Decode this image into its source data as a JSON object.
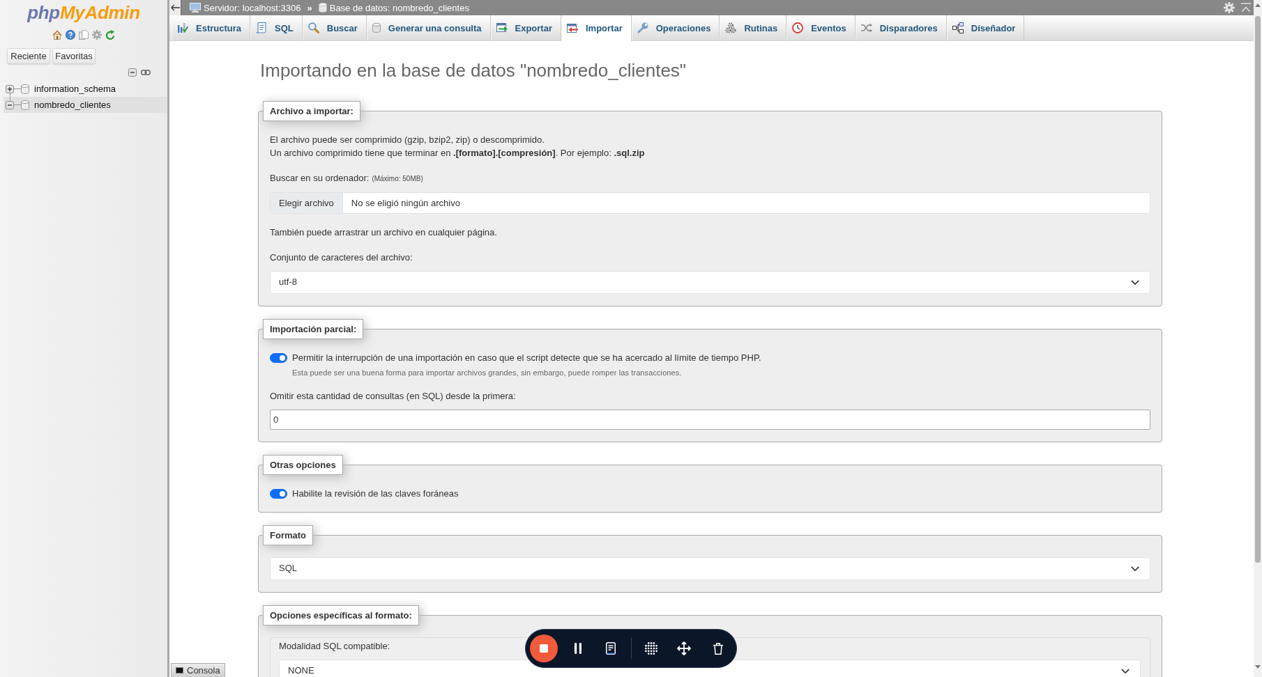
{
  "sidebar": {
    "logo": {
      "prefix": "php",
      "name": "MyAdmin"
    },
    "buttons": [
      "Reciente",
      "Favoritas"
    ],
    "databases": [
      {
        "name": "information_schema",
        "expanded": false,
        "selected": false
      },
      {
        "name": "nombredo_clientes",
        "expanded": true,
        "selected": true
      }
    ]
  },
  "breadcrumb": [
    {
      "kind": "server",
      "label": "Servidor: localhost:3306"
    },
    {
      "kind": "separator",
      "label": "»"
    },
    {
      "kind": "database",
      "label": "Base de datos: nombredo_clientes"
    }
  ],
  "tabs": [
    {
      "label": "Estructura",
      "selected": false
    },
    {
      "label": "SQL",
      "selected": false
    },
    {
      "label": "Buscar",
      "selected": false
    },
    {
      "label": "Generar una consulta",
      "selected": false
    },
    {
      "label": "Exportar",
      "selected": false
    },
    {
      "label": "Importar",
      "selected": true
    },
    {
      "label": "Operaciones",
      "selected": false
    },
    {
      "label": "Rutinas",
      "selected": false
    },
    {
      "label": "Eventos",
      "selected": false
    },
    {
      "label": "Disparadores",
      "selected": false
    },
    {
      "label": "Diseñador",
      "selected": false
    }
  ],
  "page_title": "Importando en la base de datos \"nombredo_clientes\"",
  "sections": [
    {
      "legend": "Archivo a importar:",
      "items": [
        {
          "kind": "paragraph",
          "lines": [
            "El archivo puede ser comprimido (gzip, bzip2, zip) o descomprimido.",
            "Un archivo comprimido tiene que terminar en **.[formato].[compresión]**. Por ejemplo: **.sql.zip**"
          ]
        },
        {
          "kind": "label",
          "text": "Buscar en su ordenador:",
          "note": "(Máximo: 50MB)"
        },
        {
          "kind": "file",
          "button": "Elegir archivo",
          "value": "No se eligió ningún archivo"
        },
        {
          "kind": "text",
          "text": "También puede arrastrar un archivo en cualquier página."
        },
        {
          "kind": "label",
          "text": "Conjunto de caracteres del archivo:"
        },
        {
          "kind": "select",
          "value": "utf-8"
        }
      ]
    },
    {
      "legend": "Importación parcial:",
      "items": [
        {
          "kind": "toggle",
          "label": "Permitir la interrupción de una importación en caso que el script detecte que se ha acercado al límite de tiempo PHP.",
          "checked": true,
          "hint": "Esta puede ser una buena forma para importar archivos grandes, sin embargo, puede romper las transacciones."
        },
        {
          "kind": "label",
          "text": "Omitir esta cantidad de consultas (en SQL) desde la primera:"
        },
        {
          "kind": "input",
          "value": "0"
        }
      ]
    },
    {
      "legend": "Otras opciones",
      "items": [
        {
          "kind": "toggle",
          "label": "Habilite la revisión de las claves foráneas",
          "checked": true
        }
      ]
    },
    {
      "legend": "Formato",
      "items": [
        {
          "kind": "select",
          "value": "SQL"
        }
      ]
    },
    {
      "legend": "Opciones específicas al formato:",
      "items": [
        {
          "kind": "group",
          "items": [
            {
              "kind": "label",
              "text": "Modalidad SQL compatible:"
            },
            {
              "kind": "select",
              "value": "NONE"
            }
          ]
        }
      ]
    }
  ],
  "console": {
    "label": "Consola"
  }
}
